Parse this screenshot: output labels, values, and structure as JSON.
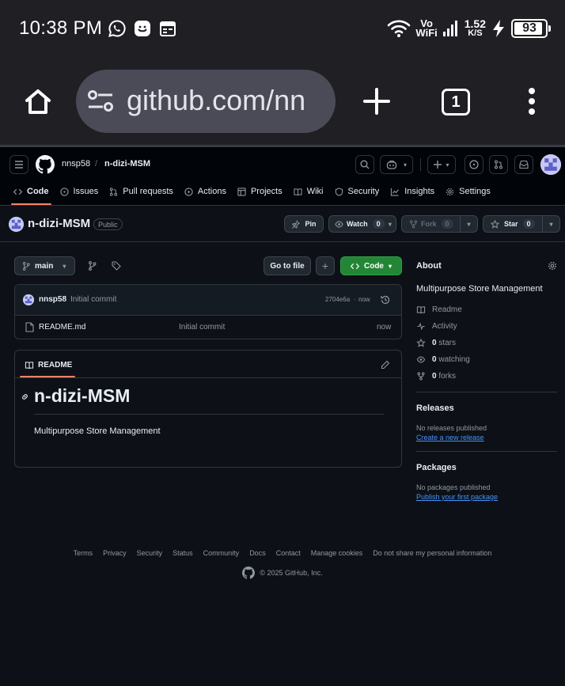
{
  "status_bar": {
    "time": "10:38 PM",
    "network_top": "Vo",
    "network_bottom": "WiFi",
    "speed_value": "1.52",
    "speed_unit": "K/S",
    "battery": "93",
    "battery_level": 0.93
  },
  "browser": {
    "url": "github.com/nn",
    "tab_count": "1"
  },
  "github": {
    "owner": "nnsp58",
    "separator": "/",
    "repo": "n-dizi-MSM",
    "nav": [
      "Code",
      "Issues",
      "Pull requests",
      "Actions",
      "Projects",
      "Wiki",
      "Security",
      "Insights",
      "Settings"
    ],
    "visibility": "Public",
    "pin_label": "Pin",
    "watch_label": "Watch",
    "watch_count": "0",
    "fork_label": "Fork",
    "fork_count": "0",
    "star_label": "Star",
    "star_count": "0",
    "branch": "main",
    "go_to_file": "Go to file",
    "add_symbol": "+",
    "code_label": "Code",
    "commit": {
      "author": "nnsp58",
      "message": "Initial commit",
      "hash": "2704e6a",
      "separator": "·",
      "time": "now"
    },
    "files": [
      {
        "name": "README.md",
        "message": "Initial commit",
        "time": "now"
      }
    ],
    "readme": {
      "tab": "README",
      "heading": "n-dizi-MSM",
      "body": "Multipurpose Store Management"
    },
    "about": {
      "title": "About",
      "description": "Multipurpose Store Management",
      "readme": "Readme",
      "activity": "Activity",
      "stars_count": "0",
      "stars_label": "stars",
      "watching_count": "0",
      "watching_label": "watching",
      "forks_count": "0",
      "forks_label": "forks"
    },
    "releases": {
      "title": "Releases",
      "empty": "No releases published",
      "link": "Create a new release"
    },
    "packages": {
      "title": "Packages",
      "empty": "No packages published",
      "link": "Publish your first package"
    },
    "footer_links": [
      "Terms",
      "Privacy",
      "Security",
      "Status",
      "Community",
      "Docs",
      "Contact",
      "Manage cookies",
      "Do not share my personal information"
    ],
    "copyright": "© 2025 GitHub, Inc."
  },
  "colors": {
    "accent_green": "#238636",
    "link_blue": "#4493f8",
    "nav_underline": "#f78166",
    "page_bg": "#0d1117"
  },
  "icons": [
    "whatsapp-icon",
    "smiley-app-icon",
    "calendar-icon",
    "wifi-icon",
    "signal-icon",
    "charging-icon",
    "home-icon",
    "site-settings-icon",
    "new-tab-icon",
    "menu-dots-icon",
    "hamburger-icon",
    "github-logo-icon",
    "search-icon",
    "copilot-icon",
    "plus-icon",
    "issues-icon",
    "pull-request-icon",
    "inbox-icon"
  ]
}
